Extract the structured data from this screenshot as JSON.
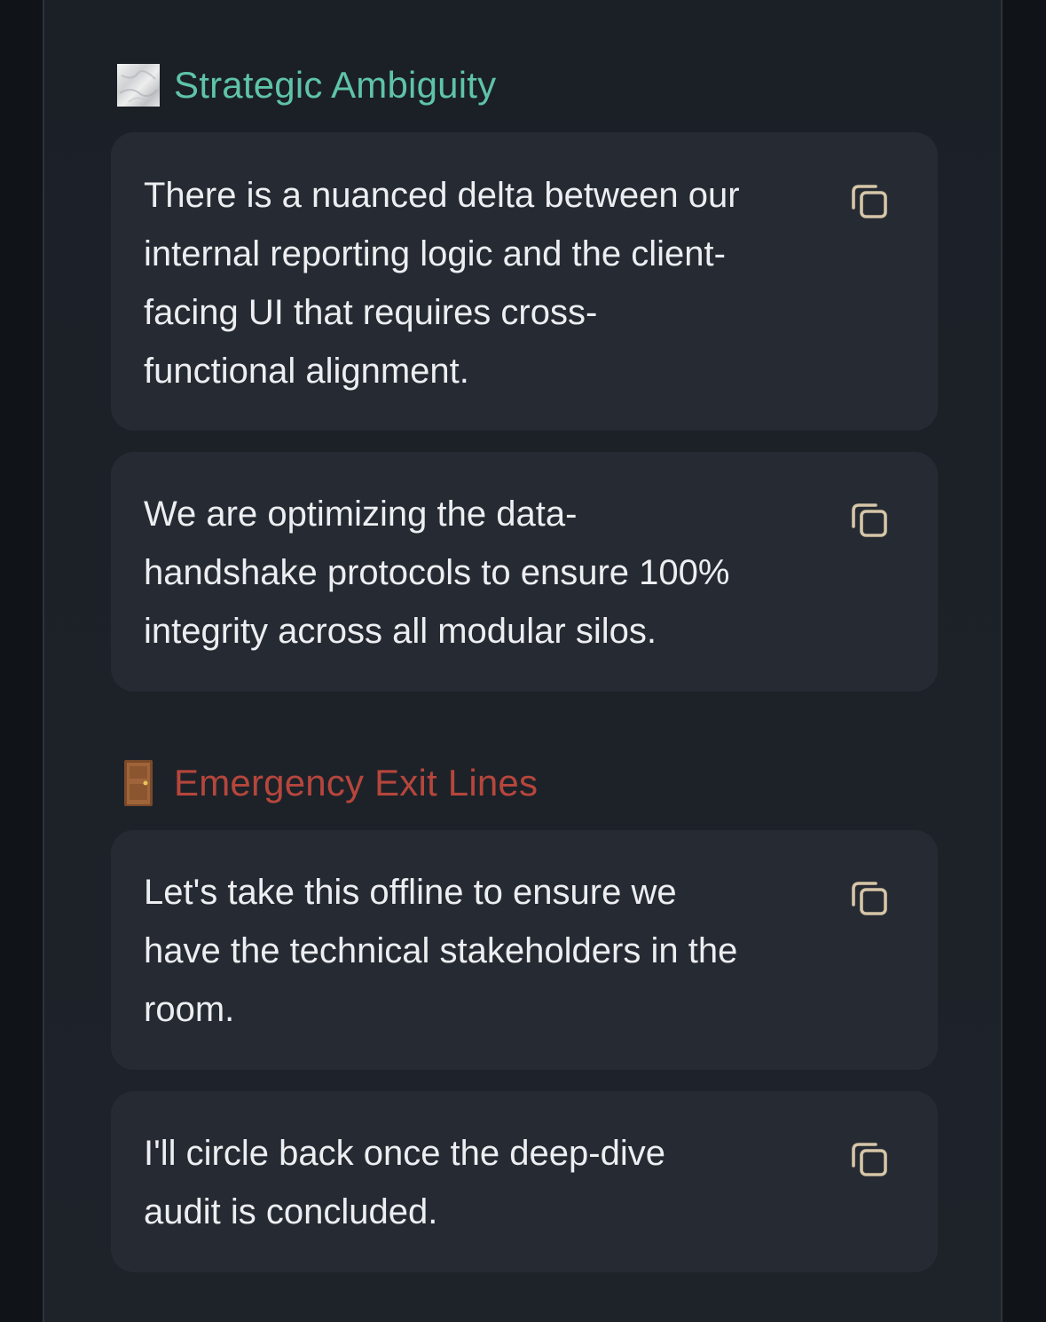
{
  "colors": {
    "section_1_title": "#5fc4a7",
    "section_2_title": "#b6463c",
    "copy_icon": "#d6c6a8",
    "card_background": "#262b33",
    "card_text": "#eceef1"
  },
  "sections": [
    {
      "title": "Strategic Ambiguity",
      "icon": "marble-square-icon",
      "cards": [
        {
          "text": "There is a nuanced delta between our internal reporting logic and the client-facing UI that requires cross-functional alignment.",
          "lines": [
            "There is a nuanced delta between our",
            "internal reporting logic and the client-",
            "facing UI that requires cross-",
            "functional alignment."
          ],
          "action_icon": "copy-icon"
        },
        {
          "text": "We are optimizing the data-handshake protocols to ensure 100% integrity across all modular silos.",
          "lines": [
            "We are optimizing the data-",
            "handshake protocols to ensure 100%",
            "integrity across all modular silos."
          ],
          "action_icon": "copy-icon"
        }
      ]
    },
    {
      "title": "Emergency Exit Lines",
      "icon": "door-icon",
      "cards": [
        {
          "text": "Let's take this offline to ensure we have the technical stakeholders in the room.",
          "lines": [
            "Let's take this offline to ensure we",
            "have the technical stakeholders in the",
            "room."
          ],
          "action_icon": "copy-icon"
        },
        {
          "text": "I'll circle back once the deep-dive audit is concluded.",
          "lines": [
            "I'll circle back once the deep-dive",
            "audit is concluded."
          ],
          "action_icon": "copy-icon"
        }
      ]
    }
  ]
}
